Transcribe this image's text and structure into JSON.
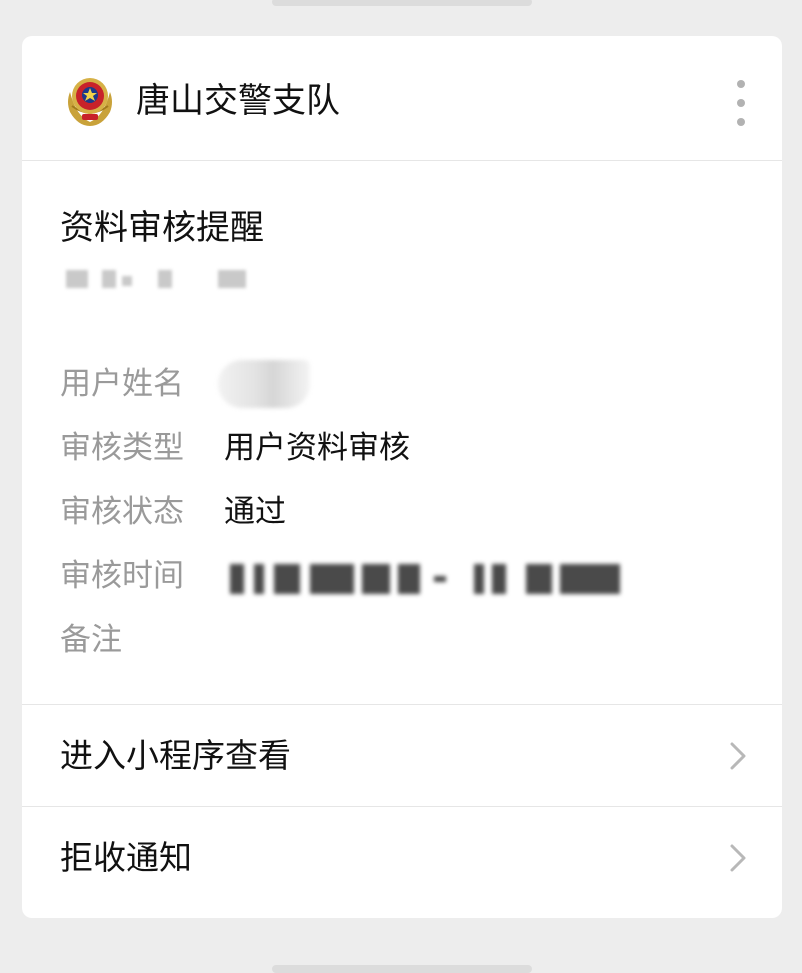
{
  "account": {
    "name": "唐山交警支队"
  },
  "message": {
    "title": "资料审核提醒"
  },
  "fields": [
    {
      "label": "用户姓名",
      "value": ""
    },
    {
      "label": "审核类型",
      "value": "用户资料审核"
    },
    {
      "label": "审核状态",
      "value": "通过"
    },
    {
      "label": "审核时间",
      "value": ""
    },
    {
      "label": "备注",
      "value": ""
    }
  ],
  "menu": {
    "open_miniprogram": "进入小程序查看",
    "refuse_notifications": "拒收通知"
  },
  "icons": {
    "avatar": "police-badge-icon",
    "more": "more-vertical-icon",
    "chevron": "chevron-right-icon"
  },
  "colors": {
    "background": "#ededed",
    "card": "#ffffff",
    "label_gray": "#9a9a9a",
    "text": "#111111"
  }
}
